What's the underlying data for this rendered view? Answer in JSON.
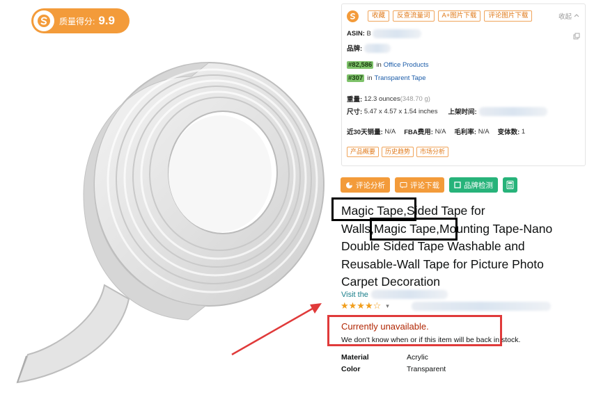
{
  "score": {
    "label": "质量得分:",
    "value": "9.9"
  },
  "toolbar": {
    "buttons": [
      "收藏",
      "反查流量词",
      "A+图片下载",
      "评论图片下载"
    ],
    "collapse": "收起"
  },
  "info": {
    "asin_label": "ASIN:",
    "asin_prefix": "B",
    "brand_label": "品牌:",
    "rank1": {
      "rank": "#82,586",
      "in": "in",
      "category": "Office Products"
    },
    "rank2": {
      "rank": "#307",
      "in": "in",
      "category": "Transparent Tape"
    },
    "weight_label": "重量:",
    "weight_value": "12.3 ounces",
    "weight_grams": "(348.70 g)",
    "size_label": "尺寸:",
    "size_value": "5.47 x 4.57 x 1.54 inches",
    "listed_label": "上架时间:",
    "sales_label": "近30天销量:",
    "sales_value": "N/A",
    "fba_label": "FBA费用:",
    "fba_value": "N/A",
    "margin_label": "毛利率:",
    "margin_value": "N/A",
    "variants_label": "变体数:",
    "variants_value": "1",
    "tabs": [
      "产品概要",
      "历史趋势",
      "市场分析"
    ]
  },
  "actions": {
    "review_analysis": "评论分析",
    "review_download": "评论下载",
    "brand_check": "品牌检测"
  },
  "product": {
    "title_line1": "Magic Tape,Sided Tape for",
    "title_line2": "Walls,Magic Tape,Mounting Tape-Nano",
    "title_line3": "Double Sided Tape Washable and",
    "title_line4": "Reusable-Wall Tape for Picture Photo",
    "title_line5": "Carpet Decoration",
    "visit_prefix": "Visit the",
    "stars": "★★★★☆",
    "availability_title": "Currently unavailable.",
    "availability_sub": "We don't know when or if this item will be back in stock.",
    "specs": [
      {
        "key": "Material",
        "value": "Acrylic"
      },
      {
        "key": "Color",
        "value": "Transparent"
      }
    ]
  },
  "colors": {
    "accent_orange": "#f39b3a",
    "badge_green": "#7ec26a",
    "button_green": "#27b37a",
    "annotation_red": "#e03a3a",
    "link_blue": "#1a5ba8"
  }
}
